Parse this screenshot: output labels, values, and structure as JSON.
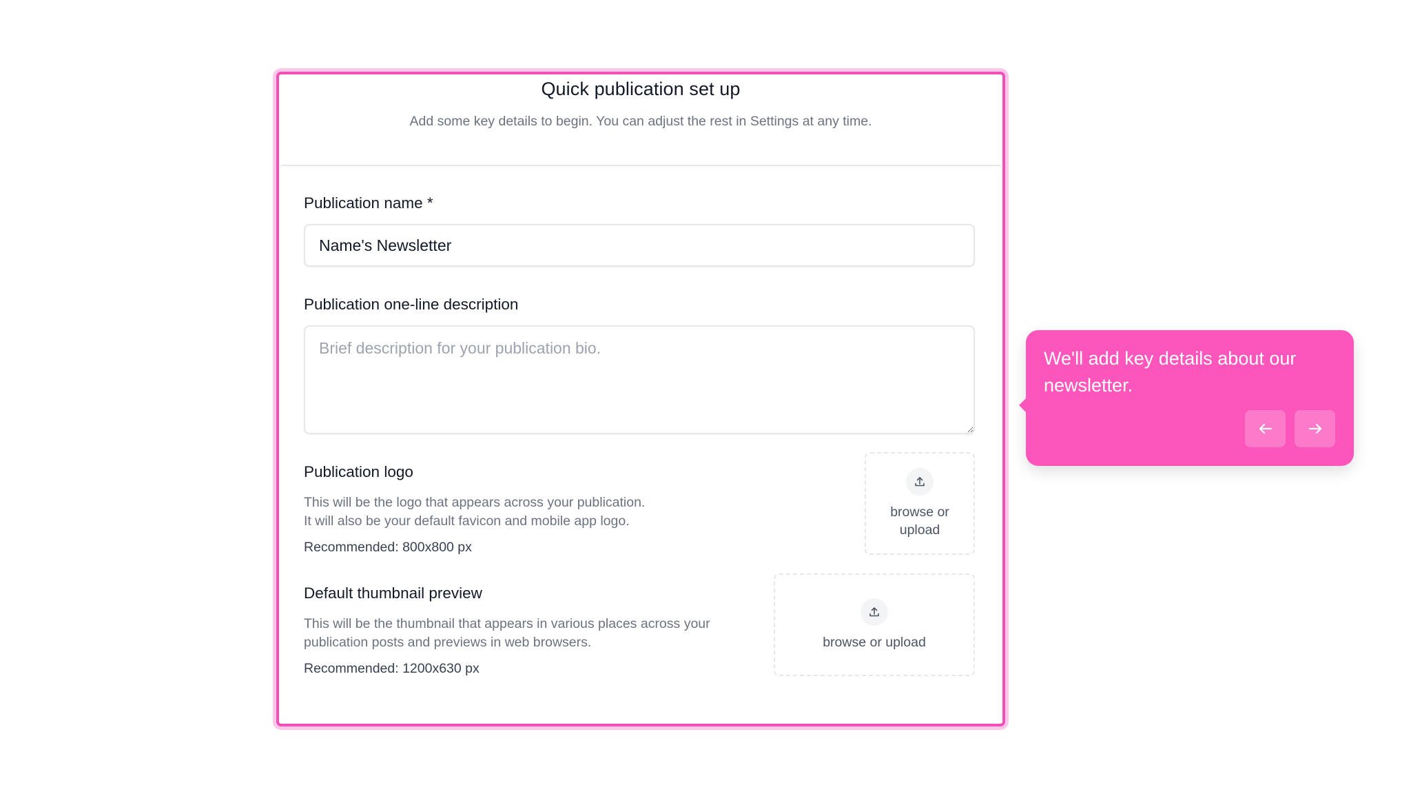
{
  "modal": {
    "title": "Quick publication set up",
    "subtitle": "Add some key details to begin. You can adjust the rest in Settings at any time."
  },
  "fields": {
    "publication_name": {
      "label": "Publication name *",
      "value": "Name's Newsletter"
    },
    "description": {
      "label": "Publication one-line description",
      "placeholder": "Brief description for your publication bio."
    },
    "logo": {
      "label": "Publication logo",
      "description_lines": [
        "This will be the logo that appears across your publication.",
        "It will also be your default favicon and mobile app logo."
      ],
      "recommended": "Recommended: 800x800 px",
      "upload_label_lines": [
        "browse or",
        "upload"
      ],
      "icon": "upload-icon"
    },
    "thumbnail": {
      "label": "Default thumbnail preview",
      "description_lines": [
        "This will be the thumbnail that appears in various places across your",
        "publication posts and previews in web browsers."
      ],
      "recommended": "Recommended: 1200x630 px",
      "upload_label": "browse or upload",
      "icon": "upload-icon"
    }
  },
  "tooltip": {
    "text": "We'll add key details about our newsletter.",
    "prev_icon": "arrow-left-icon",
    "next_icon": "arrow-right-icon",
    "background": "#fc55bb"
  },
  "colors": {
    "highlight_border": "#f050b8",
    "highlight_glow": "#fcc7e8"
  }
}
